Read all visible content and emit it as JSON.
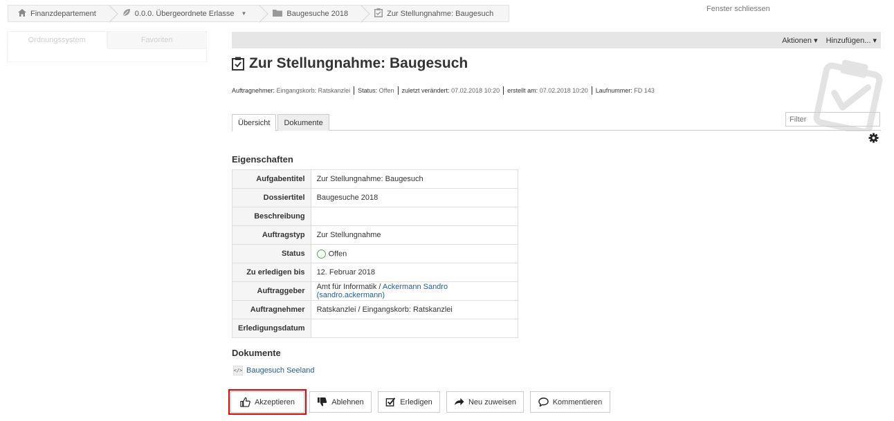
{
  "breadcrumb": [
    {
      "label": "Finanzdepartement",
      "icon": "home-icon"
    },
    {
      "label": "0.0.0. Übergeordnete Erlasse",
      "icon": "leaf-icon",
      "has_dropdown": true
    },
    {
      "label": "Baugesuche 2018",
      "icon": "folder-icon"
    },
    {
      "label": "Zur Stellungnahme: Baugesuch",
      "icon": "task-icon"
    }
  ],
  "close_window": "Fenster schliessen",
  "leftnav": {
    "tabs": [
      "Ordnungssystem",
      "Favoriten"
    ]
  },
  "actions": {
    "aktionen": "Aktionen ▾",
    "hinzufuegen": "Hinzufügen... ▾"
  },
  "title": "Zur Stellungnahme: Baugesuch",
  "meta": [
    {
      "label": "Auftragnehmer:",
      "value": "Eingangskorb: Ratskanzlei"
    },
    {
      "label": "Status:",
      "value": "Offen"
    },
    {
      "label": "zuletzt verändert:",
      "value": "07.02.2018 10:20"
    },
    {
      "label": "erstellt am:",
      "value": "07.02.2018 10:20"
    },
    {
      "label": "Laufnummer:",
      "value": "FD 143"
    }
  ],
  "tabs": [
    "Übersicht",
    "Dokumente"
  ],
  "filter": {
    "placeholder": "Filter"
  },
  "properties": {
    "heading": "Eigenschaften",
    "rows": [
      {
        "key": "Aufgabentitel",
        "value": "Zur Stellungnahme: Baugesuch"
      },
      {
        "key": "Dossiertitel",
        "value": "Baugesuche 2018"
      },
      {
        "key": "Beschreibung",
        "value": ""
      },
      {
        "key": "Auftragstyp",
        "value": "Zur Stellungnahme"
      },
      {
        "key": "Status",
        "value": "Offen"
      },
      {
        "key": "Zu erledigen bis",
        "value": "12. Februar 2018"
      },
      {
        "key": "Auftraggeber",
        "value": "Amt für Informatik / ",
        "link": "Ackermann Sandro (sandro.ackermann)"
      },
      {
        "key": "Auftragnehmer",
        "value": "Ratskanzlei / Eingangskorb: Ratskanzlei"
      },
      {
        "key": "Erledigungsdatum",
        "value": ""
      }
    ]
  },
  "documents": {
    "heading": "Dokumente",
    "items": [
      {
        "label": "Baugesuch Seeland",
        "icon_glyph": "</>"
      }
    ]
  },
  "buttons": [
    {
      "label": "Akzeptieren",
      "icon": "thumbs-up-icon"
    },
    {
      "label": "Ablehnen",
      "icon": "thumbs-down-icon"
    },
    {
      "label": "Erledigen",
      "icon": "check-square-icon"
    },
    {
      "label": "Neu zuweisen",
      "icon": "arrow-right-icon"
    },
    {
      "label": "Kommentieren",
      "icon": "comment-icon"
    }
  ],
  "colors": {
    "highlight": "#e00000",
    "link": "#1f5c99",
    "status_open": "#4caf50"
  }
}
